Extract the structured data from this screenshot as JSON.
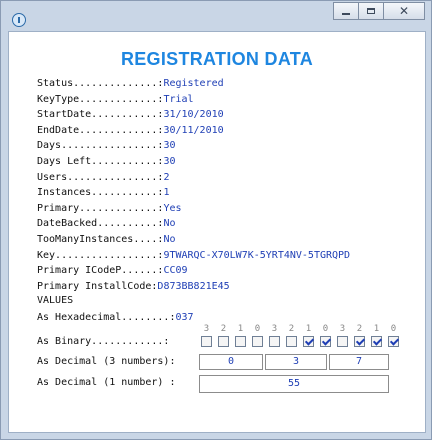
{
  "window": {
    "title": ""
  },
  "header": {
    "title": "REGISTRATION DATA"
  },
  "fields": [
    {
      "label": "Status..............:",
      "value": "Registered"
    },
    {
      "label": "KeyType.............:",
      "value": "Trial"
    },
    {
      "label": "StartDate...........:",
      "value": "31/10/2010"
    },
    {
      "label": "EndDate.............:",
      "value": "30/11/2010"
    },
    {
      "label": "Days................:",
      "value": "30"
    },
    {
      "label": "Days Left...........:",
      "value": "30"
    },
    {
      "label": "Users...............:",
      "value": "2"
    },
    {
      "label": "Instances...........:",
      "value": "1"
    },
    {
      "label": "Primary.............:",
      "value": "Yes"
    },
    {
      "label": "DateBacked..........:",
      "value": "No"
    },
    {
      "label": "TooManyInstances....:",
      "value": "No"
    },
    {
      "label": "Key.................:",
      "value": "9TWARQC-X70LW7K-5YRT4NV-5TGRQPD"
    },
    {
      "label": "Primary ICodeP......:",
      "value": "CC09"
    },
    {
      "label": "Primary InstallCode:",
      "value": "D873BB821E45"
    }
  ],
  "values_section": {
    "heading": "VALUES",
    "hex_label": "As Hexadecimal........:",
    "hex_value": "037",
    "binary_label": "As Binary............:",
    "bit_labels": [
      "3",
      "2",
      "1",
      "0",
      "3",
      "2",
      "1",
      "0",
      "3",
      "2",
      "1",
      "0"
    ],
    "bits": [
      false,
      false,
      false,
      false,
      false,
      false,
      true,
      true,
      false,
      true,
      true,
      true
    ],
    "decimal3_label": "As Decimal (3 numbers):",
    "decimal3_values": [
      "0",
      "3",
      "7"
    ],
    "decimal1_label": "As Decimal (1 number) :",
    "decimal1_value": "55"
  }
}
